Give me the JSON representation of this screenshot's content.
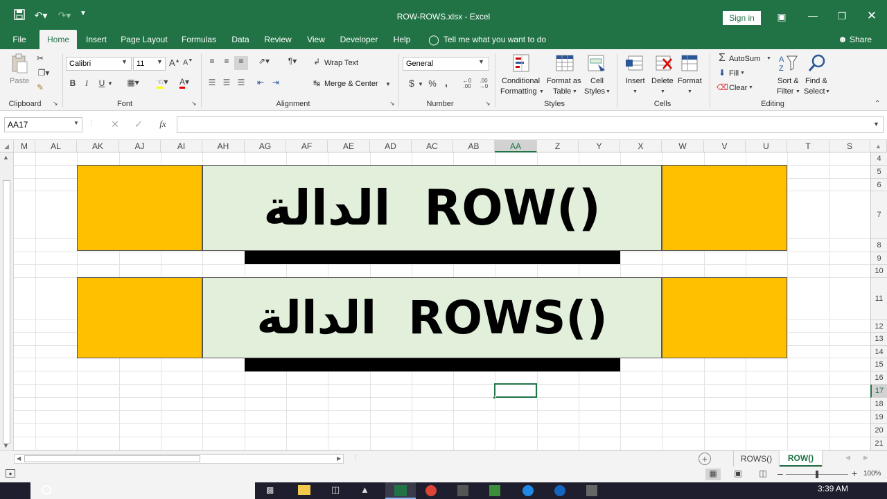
{
  "window": {
    "title": "ROW-ROWS.xlsx  -  Excel",
    "sign_in": "Sign in"
  },
  "ribbon_tabs": [
    "File",
    "Home",
    "Insert",
    "Page Layout",
    "Formulas",
    "Data",
    "Review",
    "View",
    "Developer",
    "Help"
  ],
  "tell_me": "Tell me what you want to do",
  "share": "Share",
  "clipboard": {
    "paste": "Paste",
    "group": "Clipboard"
  },
  "font": {
    "name": "Calibri",
    "size": "11",
    "group": "Font",
    "bold": "B",
    "italic": "I",
    "underline": "U"
  },
  "alignment": {
    "wrap": "Wrap Text",
    "merge": "Merge & Center",
    "group": "Alignment"
  },
  "number": {
    "format": "General",
    "currency": "$",
    "percent": "%",
    "comma": ",",
    "group": "Number"
  },
  "styles": {
    "cond_1": "Conditional",
    "cond_2": "Formatting",
    "table_1": "Format as",
    "table_2": "Table",
    "cell_1": "Cell",
    "cell_2": "Styles",
    "group": "Styles"
  },
  "cells": {
    "insert": "Insert",
    "delete": "Delete",
    "format": "Format",
    "group": "Cells"
  },
  "editing": {
    "autosum": "AutoSum",
    "fill": "Fill",
    "clear": "Clear",
    "sort_1": "Sort &",
    "sort_2": "Filter",
    "find_1": "Find &",
    "find_2": "Select",
    "group": "Editing"
  },
  "formula_bar": {
    "name_box": "AA17",
    "fx": "fx",
    "value": ""
  },
  "columns": [
    "M",
    "AL",
    "AK",
    "AJ",
    "AI",
    "AH",
    "AG",
    "AF",
    "AE",
    "AD",
    "AC",
    "AB",
    "AA",
    "Z",
    "Y",
    "X",
    "W",
    "V",
    "U",
    "T",
    "S"
  ],
  "rows": [
    "4",
    "5",
    "6",
    "7",
    "8",
    "9",
    "10",
    "11",
    "12",
    "13",
    "14",
    "15",
    "16",
    "17",
    "18",
    "19",
    "20",
    "21"
  ],
  "banners": {
    "row_title": "الدالة  ROW()",
    "rows_title": "الدالة  ROWS()"
  },
  "colors": {
    "excel_green": "#217346",
    "banner_orange": "#FFC000",
    "banner_light": "#E2EFDA",
    "bar_black": "#000000"
  },
  "sheets": {
    "tab1": "ROWS()",
    "tab2": "ROW()",
    "active": "ROW()"
  },
  "status": {
    "zoom": "100%"
  },
  "taskbar": {
    "time": "3:39 AM"
  }
}
